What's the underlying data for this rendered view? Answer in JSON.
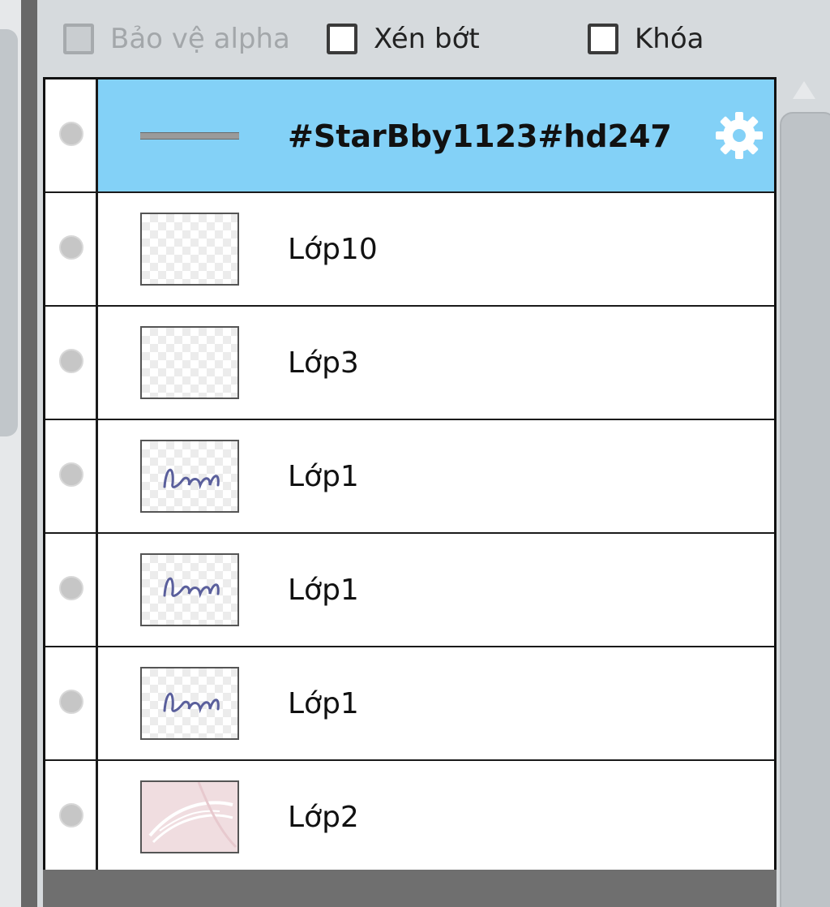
{
  "options": {
    "alpha_protect_label": "Bảo vệ alpha",
    "clip_label": "Xén bớt",
    "lock_label": "Khóa"
  },
  "layers": [
    {
      "name": "#StarBby1123#hd247",
      "selected": true,
      "thumbnail": "line"
    },
    {
      "name": "Lớp10",
      "selected": false,
      "thumbnail": "transparent"
    },
    {
      "name": "Lớp3",
      "selected": false,
      "thumbnail": "transparent"
    },
    {
      "name": "Lớp1",
      "selected": false,
      "thumbnail": "script-text"
    },
    {
      "name": "Lớp1",
      "selected": false,
      "thumbnail": "script-text"
    },
    {
      "name": "Lớp1",
      "selected": false,
      "thumbnail": "script-text"
    },
    {
      "name": "Lớp2",
      "selected": false,
      "thumbnail": "pink-swoosh"
    }
  ],
  "colors": {
    "selected_row": "#83d1f7",
    "gear_icon": "#ffffff"
  },
  "icons": {
    "selected_layer_action": "gear-icon",
    "visibility": "visibility-dot-icon"
  }
}
